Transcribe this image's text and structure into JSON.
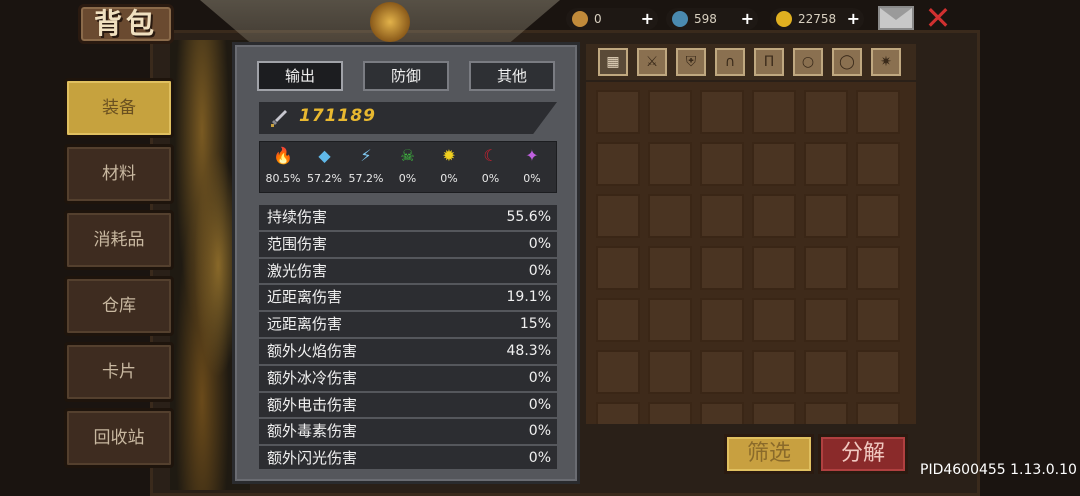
{
  "title": "背包",
  "sidebar": {
    "items": [
      {
        "label": "装备",
        "active": true
      },
      {
        "label": "材料",
        "active": false
      },
      {
        "label": "消耗品",
        "active": false
      },
      {
        "label": "仓库",
        "active": false
      },
      {
        "label": "卡片",
        "active": false
      },
      {
        "label": "回收站",
        "active": false
      }
    ]
  },
  "currency": [
    {
      "icon": "bag-icon",
      "value": "0",
      "color": "#c08a3a"
    },
    {
      "icon": "gem-icon",
      "value": "598",
      "color": "#4a8ab0"
    },
    {
      "icon": "coin-icon",
      "value": "22758",
      "color": "#e0b020"
    }
  ],
  "popup": {
    "tabs": [
      "输出",
      "防御",
      "其他"
    ],
    "active_tab": 0,
    "power": "171189",
    "elements": [
      {
        "icon": "fire-icon",
        "glyph": "🔥",
        "color": "#e06020",
        "value": "80.5%"
      },
      {
        "icon": "ice-icon",
        "glyph": "◆",
        "color": "#60b8e8",
        "value": "57.2%"
      },
      {
        "icon": "lightning-icon",
        "glyph": "⚡",
        "color": "#80c8f0",
        "value": "57.2%"
      },
      {
        "icon": "poison-skull-icon",
        "glyph": "☠",
        "color": "#40c040",
        "value": "0%"
      },
      {
        "icon": "light-sun-icon",
        "glyph": "✹",
        "color": "#f0d020",
        "value": "0%"
      },
      {
        "icon": "dark-moon-icon",
        "glyph": "☾",
        "color": "#d02030",
        "value": "0%"
      },
      {
        "icon": "arcane-icon",
        "glyph": "✦",
        "color": "#c060e0",
        "value": "0%"
      }
    ],
    "stats": [
      {
        "label": "持续伤害",
        "value": "55.6%"
      },
      {
        "label": "范围伤害",
        "value": "0%"
      },
      {
        "label": "激光伤害",
        "value": "0%"
      },
      {
        "label": "近距离伤害",
        "value": "19.1%"
      },
      {
        "label": "远距离伤害",
        "value": "15%"
      },
      {
        "label": "额外火焰伤害",
        "value": "48.3%"
      },
      {
        "label": "额外冰冷伤害",
        "value": "0%"
      },
      {
        "label": "额外电击伤害",
        "value": "0%"
      },
      {
        "label": "额外毒素伤害",
        "value": "0%"
      },
      {
        "label": "额外闪光伤害",
        "value": "0%"
      }
    ]
  },
  "inventory": {
    "category_tabs": [
      {
        "icon": "grid-all-icon",
        "glyph": "▦",
        "active": true
      },
      {
        "icon": "weapon-icon",
        "glyph": "⚔",
        "active": false
      },
      {
        "icon": "armor-icon",
        "glyph": "⛨",
        "active": false
      },
      {
        "icon": "helmet-icon",
        "glyph": "∩",
        "active": false
      },
      {
        "icon": "pants-icon",
        "glyph": "Π",
        "active": false
      },
      {
        "icon": "necklace-icon",
        "glyph": "○",
        "active": false
      },
      {
        "icon": "ring-icon",
        "glyph": "◯",
        "active": false
      },
      {
        "icon": "gem-slot-icon",
        "glyph": "✷",
        "active": false
      }
    ],
    "filter_label": "筛选",
    "dismantle_label": "分解"
  },
  "version": "PID4600455 1.13.0.10"
}
